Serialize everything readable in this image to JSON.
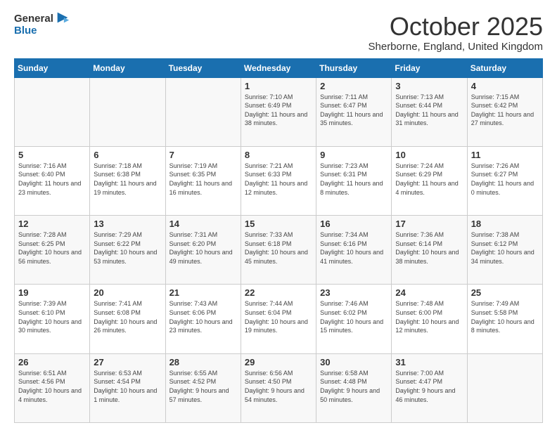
{
  "header": {
    "logo": {
      "general": "General",
      "blue": "Blue"
    },
    "title": "October 2025",
    "subtitle": "Sherborne, England, United Kingdom"
  },
  "weekdays": [
    "Sunday",
    "Monday",
    "Tuesday",
    "Wednesday",
    "Thursday",
    "Friday",
    "Saturday"
  ],
  "weeks": [
    [
      {
        "day": "",
        "info": ""
      },
      {
        "day": "",
        "info": ""
      },
      {
        "day": "",
        "info": ""
      },
      {
        "day": "1",
        "info": "Sunrise: 7:10 AM\nSunset: 6:49 PM\nDaylight: 11 hours and 38 minutes."
      },
      {
        "day": "2",
        "info": "Sunrise: 7:11 AM\nSunset: 6:47 PM\nDaylight: 11 hours and 35 minutes."
      },
      {
        "day": "3",
        "info": "Sunrise: 7:13 AM\nSunset: 6:44 PM\nDaylight: 11 hours and 31 minutes."
      },
      {
        "day": "4",
        "info": "Sunrise: 7:15 AM\nSunset: 6:42 PM\nDaylight: 11 hours and 27 minutes."
      }
    ],
    [
      {
        "day": "5",
        "info": "Sunrise: 7:16 AM\nSunset: 6:40 PM\nDaylight: 11 hours and 23 minutes."
      },
      {
        "day": "6",
        "info": "Sunrise: 7:18 AM\nSunset: 6:38 PM\nDaylight: 11 hours and 19 minutes."
      },
      {
        "day": "7",
        "info": "Sunrise: 7:19 AM\nSunset: 6:35 PM\nDaylight: 11 hours and 16 minutes."
      },
      {
        "day": "8",
        "info": "Sunrise: 7:21 AM\nSunset: 6:33 PM\nDaylight: 11 hours and 12 minutes."
      },
      {
        "day": "9",
        "info": "Sunrise: 7:23 AM\nSunset: 6:31 PM\nDaylight: 11 hours and 8 minutes."
      },
      {
        "day": "10",
        "info": "Sunrise: 7:24 AM\nSunset: 6:29 PM\nDaylight: 11 hours and 4 minutes."
      },
      {
        "day": "11",
        "info": "Sunrise: 7:26 AM\nSunset: 6:27 PM\nDaylight: 11 hours and 0 minutes."
      }
    ],
    [
      {
        "day": "12",
        "info": "Sunrise: 7:28 AM\nSunset: 6:25 PM\nDaylight: 10 hours and 56 minutes."
      },
      {
        "day": "13",
        "info": "Sunrise: 7:29 AM\nSunset: 6:22 PM\nDaylight: 10 hours and 53 minutes."
      },
      {
        "day": "14",
        "info": "Sunrise: 7:31 AM\nSunset: 6:20 PM\nDaylight: 10 hours and 49 minutes."
      },
      {
        "day": "15",
        "info": "Sunrise: 7:33 AM\nSunset: 6:18 PM\nDaylight: 10 hours and 45 minutes."
      },
      {
        "day": "16",
        "info": "Sunrise: 7:34 AM\nSunset: 6:16 PM\nDaylight: 10 hours and 41 minutes."
      },
      {
        "day": "17",
        "info": "Sunrise: 7:36 AM\nSunset: 6:14 PM\nDaylight: 10 hours and 38 minutes."
      },
      {
        "day": "18",
        "info": "Sunrise: 7:38 AM\nSunset: 6:12 PM\nDaylight: 10 hours and 34 minutes."
      }
    ],
    [
      {
        "day": "19",
        "info": "Sunrise: 7:39 AM\nSunset: 6:10 PM\nDaylight: 10 hours and 30 minutes."
      },
      {
        "day": "20",
        "info": "Sunrise: 7:41 AM\nSunset: 6:08 PM\nDaylight: 10 hours and 26 minutes."
      },
      {
        "day": "21",
        "info": "Sunrise: 7:43 AM\nSunset: 6:06 PM\nDaylight: 10 hours and 23 minutes."
      },
      {
        "day": "22",
        "info": "Sunrise: 7:44 AM\nSunset: 6:04 PM\nDaylight: 10 hours and 19 minutes."
      },
      {
        "day": "23",
        "info": "Sunrise: 7:46 AM\nSunset: 6:02 PM\nDaylight: 10 hours and 15 minutes."
      },
      {
        "day": "24",
        "info": "Sunrise: 7:48 AM\nSunset: 6:00 PM\nDaylight: 10 hours and 12 minutes."
      },
      {
        "day": "25",
        "info": "Sunrise: 7:49 AM\nSunset: 5:58 PM\nDaylight: 10 hours and 8 minutes."
      }
    ],
    [
      {
        "day": "26",
        "info": "Sunrise: 6:51 AM\nSunset: 4:56 PM\nDaylight: 10 hours and 4 minutes."
      },
      {
        "day": "27",
        "info": "Sunrise: 6:53 AM\nSunset: 4:54 PM\nDaylight: 10 hours and 1 minute."
      },
      {
        "day": "28",
        "info": "Sunrise: 6:55 AM\nSunset: 4:52 PM\nDaylight: 9 hours and 57 minutes."
      },
      {
        "day": "29",
        "info": "Sunrise: 6:56 AM\nSunset: 4:50 PM\nDaylight: 9 hours and 54 minutes."
      },
      {
        "day": "30",
        "info": "Sunrise: 6:58 AM\nSunset: 4:48 PM\nDaylight: 9 hours and 50 minutes."
      },
      {
        "day": "31",
        "info": "Sunrise: 7:00 AM\nSunset: 4:47 PM\nDaylight: 9 hours and 46 minutes."
      },
      {
        "day": "",
        "info": ""
      }
    ]
  ]
}
